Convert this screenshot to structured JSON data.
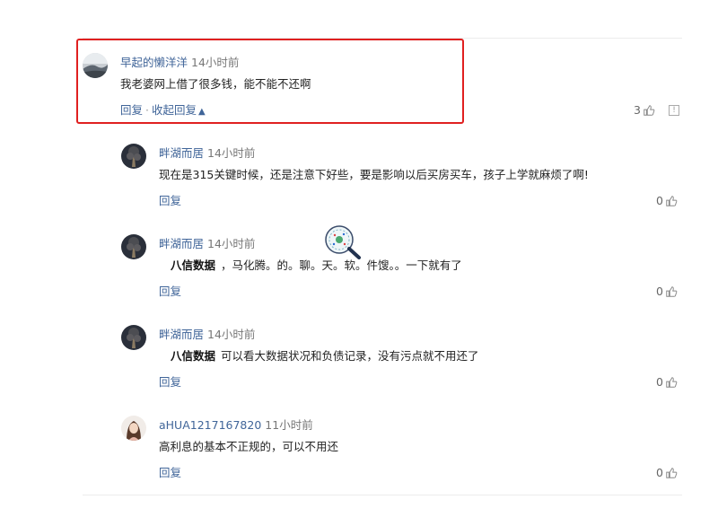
{
  "comments": [
    {
      "author": "早起的懒洋洋",
      "time": "14小时前",
      "text": "我老婆网上借了很多钱，能不能不还啊",
      "reply": "回复",
      "separator": "·",
      "collapse": "收起回复",
      "likes": "3",
      "report_icon": "report-icon"
    },
    {
      "author": "畔湖而居",
      "time": "14小时前",
      "text": "现在是315关键时候，还是注意下好些，要是影响以后买房买车，孩子上学就麻烦了啊!",
      "reply": "回复",
      "likes": "0"
    },
    {
      "author": "畔湖而居",
      "time": "14小时前",
      "brand": "八信数据",
      "text": "，马化腾。的。聊。天。软。件馊。。一下就有了",
      "reply": "回复",
      "likes": "0"
    },
    {
      "author": "畔湖而居",
      "time": "14小时前",
      "brand": "八信数据",
      "text": "可以看大数据状况和负债记录，没有污点就不用还了",
      "reply": "回复",
      "likes": "0"
    },
    {
      "author": "aHUA1217167820",
      "time": "11小时前",
      "text": "高利息的基本不正规的，可以不用还",
      "reply": "回复",
      "likes": "0"
    }
  ],
  "colors": {
    "link": "#406599",
    "highlight": "#e02020"
  }
}
